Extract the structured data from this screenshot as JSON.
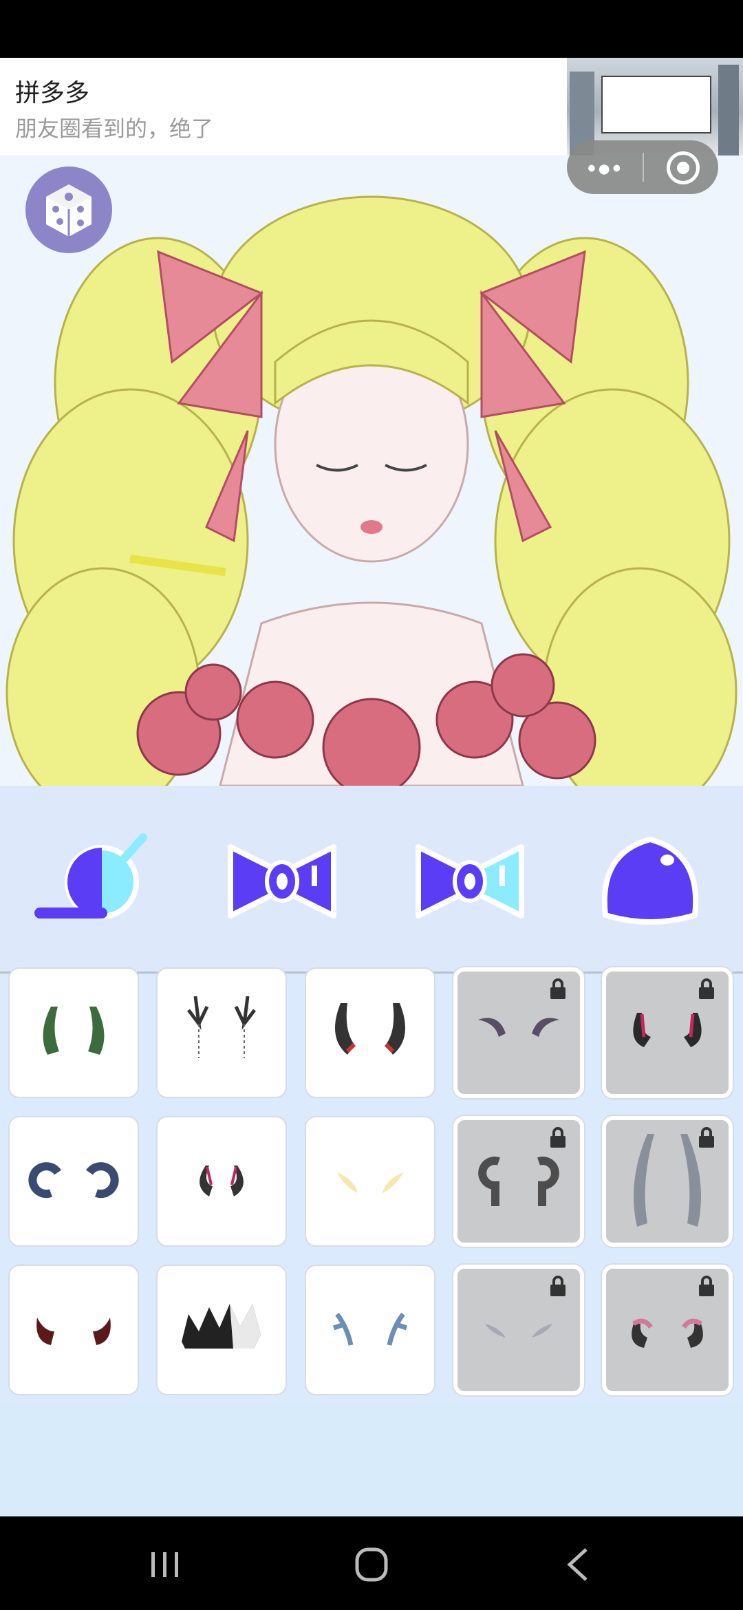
{
  "ad": {
    "title": "拼多多",
    "subtitle": "朋友圈看到的，绝了"
  },
  "capsule": {
    "more_icon": "more-dots-icon",
    "close_icon": "target-circle-icon"
  },
  "colors": {
    "accent_purple": "#5a3df5",
    "accent_cyan": "#8cecff",
    "locked_tile": "#c9cacb",
    "toolbar_bg": "#dde9fb"
  },
  "toolbar": {
    "items": [
      "hat-icon",
      "bow-icon",
      "bow-alt-icon",
      "blob-icon"
    ]
  },
  "grid": {
    "items": [
      {
        "name": "green-vine-horns",
        "locked": false
      },
      {
        "name": "antler-chains",
        "locked": false
      },
      {
        "name": "black-horns",
        "locked": false
      },
      {
        "name": "purple-curved-horns",
        "locked": true
      },
      {
        "name": "red-black-horns",
        "locked": true
      },
      {
        "name": "ram-horns",
        "locked": false
      },
      {
        "name": "small-red-horns",
        "locked": false
      },
      {
        "name": "golden-wings",
        "locked": false
      },
      {
        "name": "curly-grey-horns",
        "locked": true
      },
      {
        "name": "long-spiral-horns",
        "locked": true
      },
      {
        "name": "dark-red-horns",
        "locked": false
      },
      {
        "name": "spiked-crown",
        "locked": false
      },
      {
        "name": "blue-antlers",
        "locked": false
      },
      {
        "name": "feather-wings",
        "locked": true
      },
      {
        "name": "pink-ram-horns",
        "locked": true
      }
    ]
  }
}
